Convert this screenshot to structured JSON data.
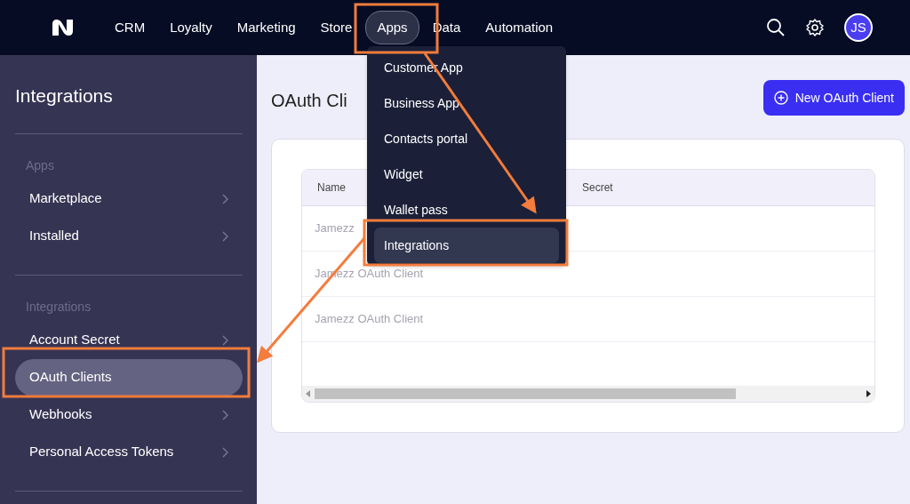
{
  "nav": {
    "items": [
      {
        "label": "CRM",
        "selected": false
      },
      {
        "label": "Loyalty",
        "selected": false
      },
      {
        "label": "Marketing",
        "selected": false
      },
      {
        "label": "Store",
        "selected": false
      },
      {
        "label": "Apps",
        "selected": true
      },
      {
        "label": "Data",
        "selected": false
      },
      {
        "label": "Automation",
        "selected": false
      }
    ],
    "avatar": "JS"
  },
  "apps_menu": {
    "items": [
      {
        "label": "Customer App",
        "selected": false
      },
      {
        "label": "Business App",
        "selected": false
      },
      {
        "label": "Contacts portal",
        "selected": false
      },
      {
        "label": "Widget",
        "selected": false
      },
      {
        "label": "Wallet pass",
        "selected": false
      },
      {
        "label": "Integrations",
        "selected": true
      }
    ]
  },
  "sidebar": {
    "title": "Integrations",
    "sections": [
      {
        "heading": "Apps",
        "items": [
          {
            "label": "Marketplace",
            "selected": false
          },
          {
            "label": "Installed",
            "selected": false
          }
        ]
      },
      {
        "heading": "Integrations",
        "items": [
          {
            "label": "Account Secret",
            "selected": false
          },
          {
            "label": "OAuth Clients",
            "selected": true
          },
          {
            "label": "Webhooks",
            "selected": false
          },
          {
            "label": "Personal Access Tokens",
            "selected": false
          }
        ]
      }
    ]
  },
  "page": {
    "title": "OAuth Cli",
    "new_button": "New OAuth Client"
  },
  "table": {
    "columns": [
      "Name",
      "Secret"
    ],
    "rows": [
      {
        "name": "Jamezz"
      },
      {
        "name": "Jamezz OAuth Client"
      },
      {
        "name": "Jamezz OAuth Client"
      }
    ]
  }
}
